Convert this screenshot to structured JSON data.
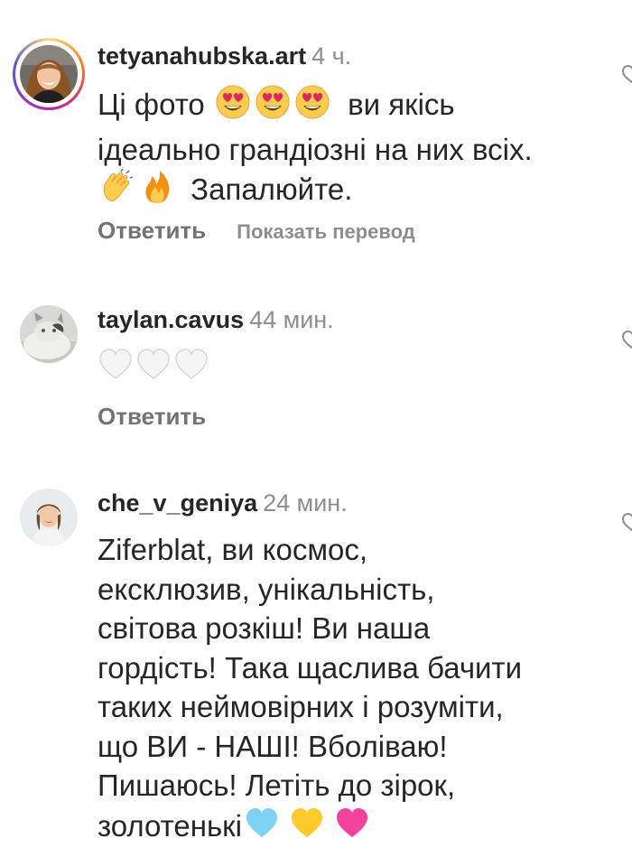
{
  "comments": [
    {
      "username": "tetyanahubska.art",
      "time": "4 ч.",
      "text_lines": [
        "Ці фото",
        "ви якісь",
        "ідеально грандіозні на них всіх.",
        "Запалюйте."
      ],
      "emojis": [
        "smiling-face-with-heart-eyes",
        "smiling-face-with-heart-eyes",
        "smiling-face-with-heart-eyes",
        "clapping-hands",
        "fire"
      ],
      "reply_label": "Ответить",
      "translate_label": "Показать перевод",
      "has_story_ring": true
    },
    {
      "username": "taylan.cavus",
      "time": "44 мин.",
      "text_lines": [],
      "emojis": [
        "white-heart",
        "white-heart",
        "white-heart"
      ],
      "reply_label": "Ответить"
    },
    {
      "username": "che_v_geniya",
      "time": "24 мин.",
      "text_lines": [
        "Ziferblat, ви космос,",
        "ексклюзив, унікальність,",
        "світова розкіш! Ви наша",
        "гордість! Така щаслива бачити",
        "таких неймовірних і розуміти,",
        "що ВИ - НАШІ! Вболіваю!",
        "Пишаюсь! Летіть до зірок,",
        "золотенькі"
      ],
      "emojis": [
        "light-blue-heart",
        "yellow-heart",
        "pink-heart"
      ]
    }
  ],
  "colors": {
    "username": "#262626",
    "time": "#8e8e8e",
    "reply": "#737373",
    "text": "#262626"
  }
}
